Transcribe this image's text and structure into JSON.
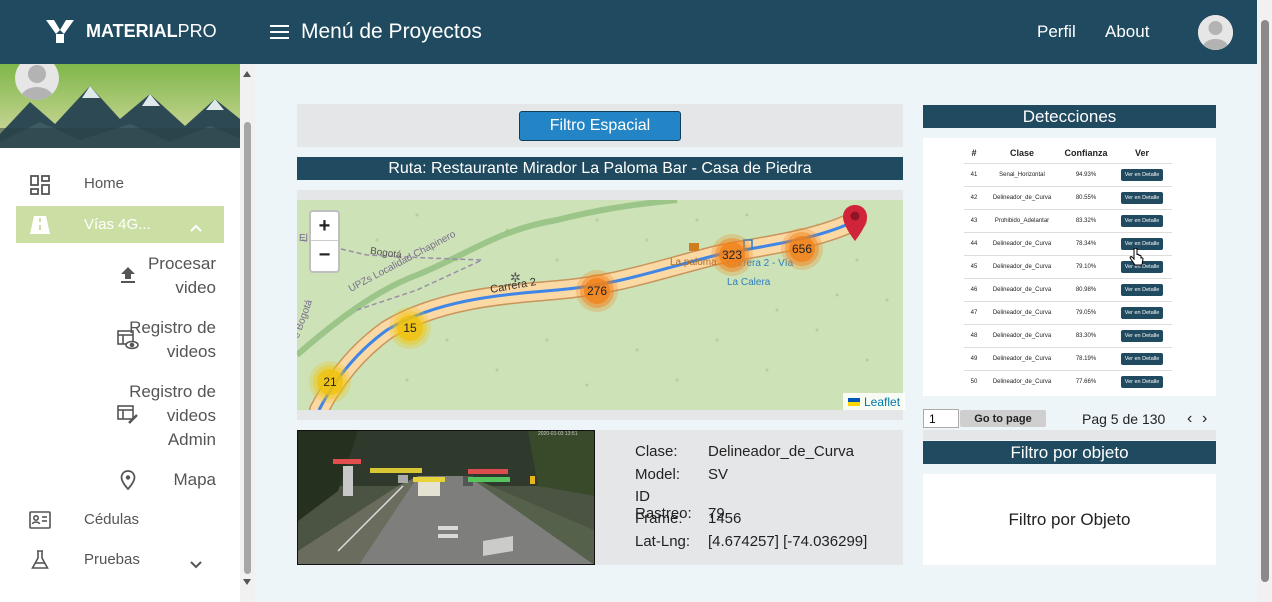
{
  "header": {
    "brand_bold": "MATERIAL",
    "brand_light": "PRO",
    "menu_title": "Menú de Proyectos",
    "links": [
      "Perfil",
      "About"
    ]
  },
  "sidebar": {
    "items": [
      {
        "label": "Home",
        "icon": "dashboard-icon"
      },
      {
        "label": "Vías 4G...",
        "icon": "road-icon",
        "active": true
      },
      {
        "label": "Procesar video",
        "icon": "upload-icon"
      },
      {
        "label": "Registro de videos",
        "icon": "table-eye-icon"
      },
      {
        "label": "Registro de videos Admin",
        "icon": "table-edit-icon"
      },
      {
        "label": "Mapa",
        "icon": "map-pin-icon"
      },
      {
        "label": "Cédulas",
        "icon": "id-card-icon"
      },
      {
        "label": "Pruebas",
        "icon": "flask-icon"
      }
    ],
    "active_color": "#cbdfa4"
  },
  "main": {
    "filter_button": "Filtro Espacial",
    "route_title": "Ruta: Restaurante Mirador La Paloma Bar - Casa de Piedra",
    "map": {
      "zoom_in": "+",
      "zoom_out": "−",
      "attribution": "Leaflet",
      "labels": {
        "road1": "Carrera 2",
        "road2": "Bogotá",
        "upz": "UPZs Localidad Chapinero",
        "place": "La paloma",
        "via1": "Carrera 2 - Vía",
        "via2": "La Calera",
        "edge1": "El",
        "edge2": "e Bogotá"
      },
      "clusters": [
        "21",
        "15",
        "276",
        "323",
        "656"
      ]
    },
    "video": {
      "timestamp": "2020-01-03 13:51"
    },
    "info": {
      "clase_label": "Clase:",
      "clase_value": "Delineador_de_Curva",
      "model_label": "Model:",
      "model_value": "SV",
      "rastreo_label": "ID Rastreo:",
      "rastreo_value": "79",
      "frame_label": "Frame:",
      "frame_value": "1456",
      "latlng_label": "Lat-Lng:",
      "latlng_value": "[4.674257] [-74.036299]"
    }
  },
  "detecciones": {
    "title": "Detecciones",
    "columns": [
      "#",
      "Clase",
      "Confianza",
      "Ver"
    ],
    "rows": [
      {
        "id": "41",
        "clase": "Senal_Horizontal",
        "conf": "94.93%",
        "ver": "Ver en Detalle"
      },
      {
        "id": "42",
        "clase": "Delineador_de_Curva",
        "conf": "80.55%",
        "ver": "Ver en Detalle"
      },
      {
        "id": "43",
        "clase": "Prohibido_Adelantar",
        "conf": "83.32%",
        "ver": "Ver en Detalle"
      },
      {
        "id": "44",
        "clase": "Delineador_de_Curva",
        "conf": "78.34%",
        "ver": "Ver en Detalle"
      },
      {
        "id": "45",
        "clase": "Delineador_de_Curva",
        "conf": "79.10%",
        "ver": "Ver en Detalle"
      },
      {
        "id": "46",
        "clase": "Delineador_de_Curva",
        "conf": "80.98%",
        "ver": "Ver en Detalle"
      },
      {
        "id": "47",
        "clase": "Delineador_de_Curva",
        "conf": "79.05%",
        "ver": "Ver en Detalle"
      },
      {
        "id": "48",
        "clase": "Delineador_de_Curva",
        "conf": "83.30%",
        "ver": "Ver en Detalle"
      },
      {
        "id": "49",
        "clase": "Delineador_de_Curva",
        "conf": "78.19%",
        "ver": "Ver en Detalle"
      },
      {
        "id": "50",
        "clase": "Delineador_de_Curva",
        "conf": "77.66%",
        "ver": "Ver en Detalle"
      }
    ],
    "page_input": "1",
    "goto_label": "Go to page",
    "page_text": "Pag 5 de 130",
    "prev": "‹",
    "next": "›"
  },
  "filtro": {
    "title": "Filtro por objeto",
    "body": "Filtro por Objeto"
  }
}
